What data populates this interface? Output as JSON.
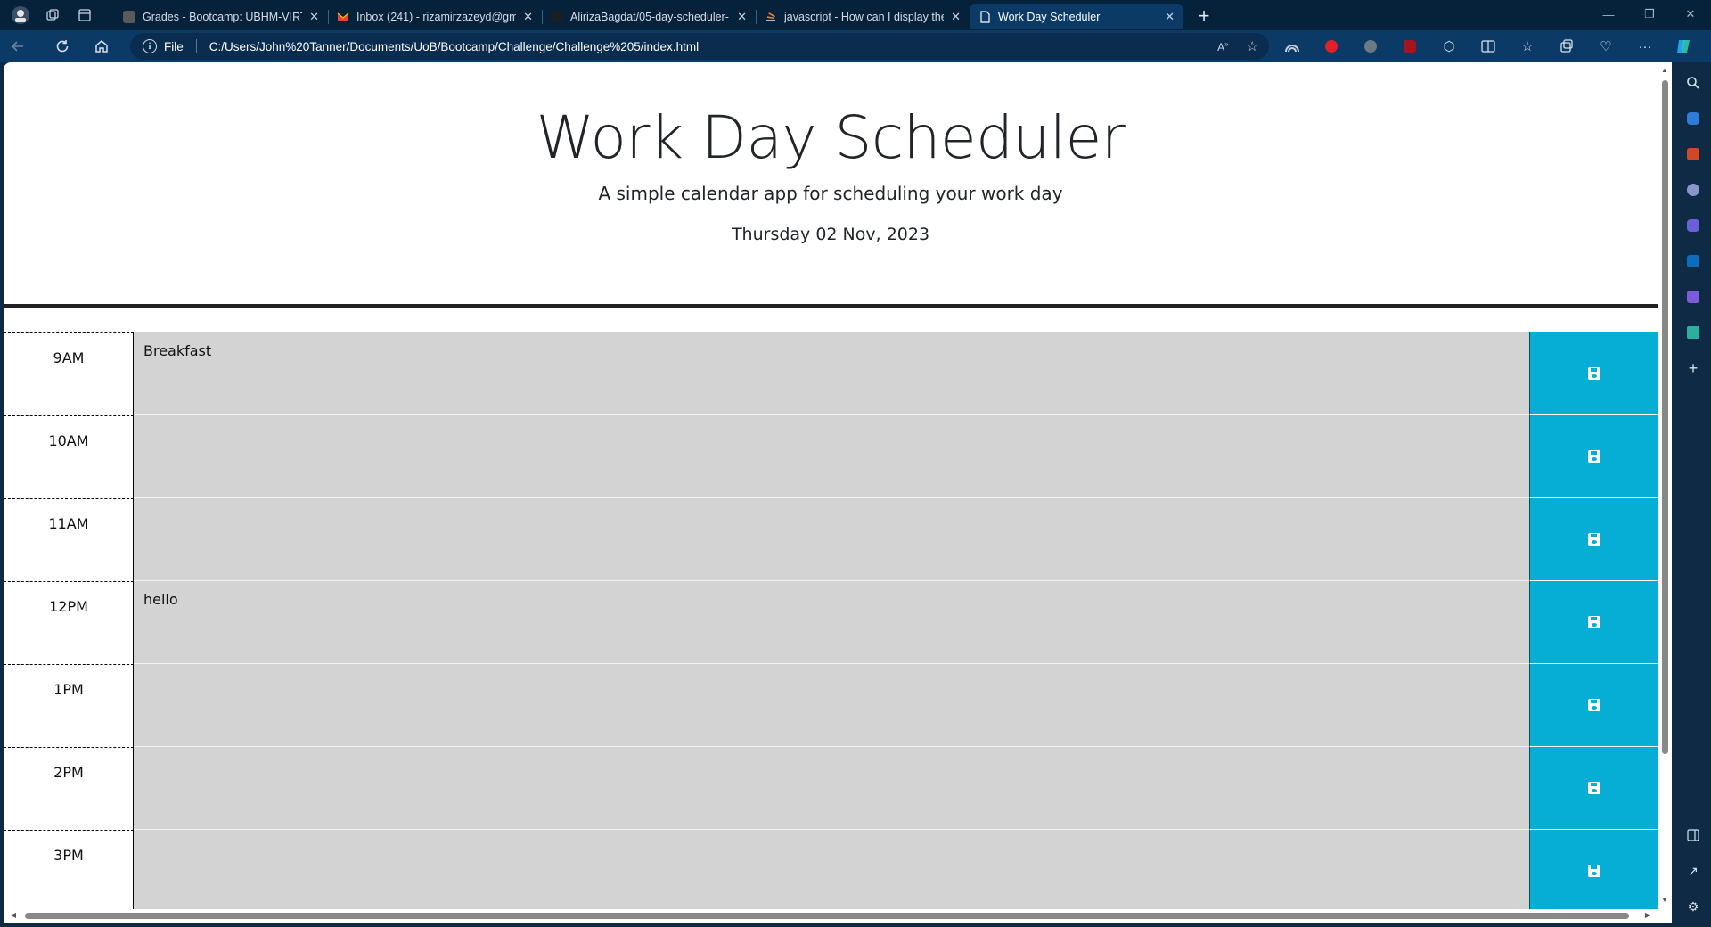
{
  "browser": {
    "tabs": [
      {
        "title": "Grades - Bootcamp: UBHM-VIRT",
        "favicon_color": "#5a5a5a",
        "active": false
      },
      {
        "title": "Inbox (241) - rizamirzazeyd@gm",
        "favicon_color": "#d93025",
        "active": false
      },
      {
        "title": "AlirizaBagdat/05-day-scheduler-",
        "favicon_color": "#24292e",
        "active": false
      },
      {
        "title": "javascript - How can I display the",
        "favicon_color": "#e87922",
        "active": false
      },
      {
        "title": "Work Day Scheduler",
        "favicon_color": "#ffffff",
        "active": true
      }
    ],
    "new_tab_label": "+",
    "address": {
      "scheme": "File",
      "url": "C:/Users/John%20Tanner/Documents/UoB/Bootcamp/Challenge/Challenge%205/index.html"
    }
  },
  "header": {
    "title": "Work Day Scheduler",
    "subtitle": "A simple calendar app for scheduling your work day",
    "current_day": "Thursday 02 Nov, 2023"
  },
  "schedule": [
    {
      "hour": "9AM",
      "text": "Breakfast"
    },
    {
      "hour": "10AM",
      "text": ""
    },
    {
      "hour": "11AM",
      "text": ""
    },
    {
      "hour": "12PM",
      "text": "hello"
    },
    {
      "hour": "1PM",
      "text": ""
    },
    {
      "hour": "2PM",
      "text": ""
    },
    {
      "hour": "3PM",
      "text": ""
    }
  ],
  "colors": {
    "past": "#d3d3d3",
    "save_button": "#06aed5",
    "browser_toolbar": "#0b3a66"
  },
  "icons": {
    "save": "floppy-disk-icon"
  }
}
